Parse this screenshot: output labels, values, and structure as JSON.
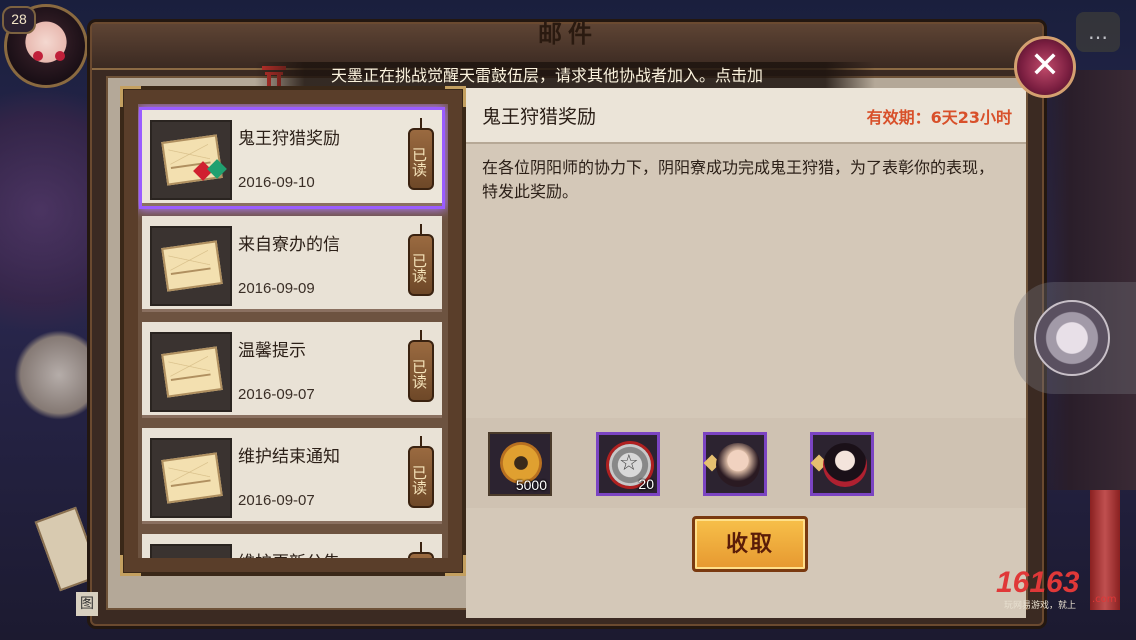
{
  "player": {
    "level": "28"
  },
  "window": {
    "title": "邮件"
  },
  "marquee": {
    "text": "天墨正在挑战觉醒天雷鼓伍层，请求其他协战者加入。点击加"
  },
  "mail_list": [
    {
      "title": "鬼王狩猎奖励",
      "date": "2016-09-10",
      "status": "已读",
      "selected": true
    },
    {
      "title": "来自寮办的信",
      "date": "2016-09-09",
      "status": "已读",
      "selected": false
    },
    {
      "title": "温馨提示",
      "date": "2016-09-07",
      "status": "已读",
      "selected": false
    },
    {
      "title": "维护结束通知",
      "date": "2016-09-07",
      "status": "已读",
      "selected": false
    },
    {
      "title": "维护更新公告",
      "date": "",
      "status": "已读",
      "selected": false
    }
  ],
  "detail": {
    "title": "鬼王狩猎奖励",
    "expiry": "有效期：6天23小时",
    "body": "在各位阴阳师的协力下，阴阳寮成功完成鬼王狩猎，为了表彰你的表现，特发此奖励。"
  },
  "rewards": [
    {
      "icon": "gold-coin-icon",
      "count": "5000"
    },
    {
      "icon": "silver-amulet-icon",
      "count": "20"
    },
    {
      "icon": "shikigami-portrait-icon",
      "count": ""
    },
    {
      "icon": "shikigami-portrait-icon",
      "count": ""
    }
  ],
  "buttons": {
    "claim": "收取",
    "close": "✕",
    "chat": "…"
  },
  "watermark": {
    "logo": "16163",
    "sub": "玩网易游戏，就上",
    "domain": ".com"
  },
  "colors": {
    "accent_purple": "#9a5cff",
    "expiry_red": "#d8502a",
    "claim_orange": "#f0a838"
  }
}
